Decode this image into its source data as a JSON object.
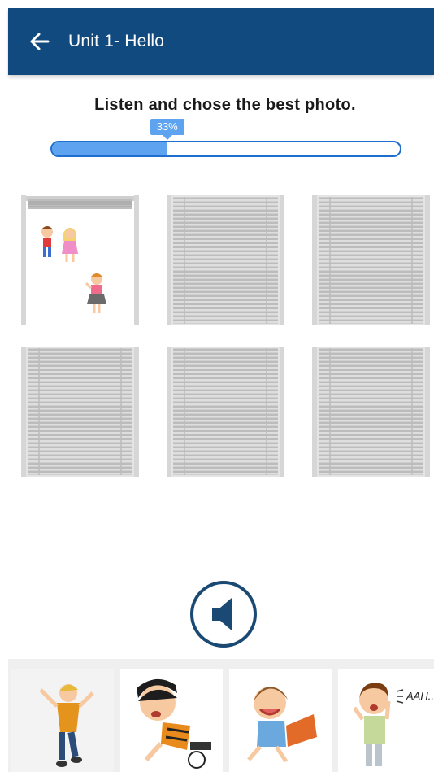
{
  "header": {
    "title": "Unit 1- Hello"
  },
  "instruction": "Listen and chose the best photo.",
  "progress": {
    "value": 33,
    "label": "33%"
  },
  "grid": [
    {
      "state": "revealed"
    },
    {
      "state": "closed"
    },
    {
      "state": "closed"
    },
    {
      "state": "closed"
    },
    {
      "state": "closed"
    },
    {
      "state": "closed"
    }
  ],
  "answers": [
    {
      "name": "boy-jumping"
    },
    {
      "name": "boy-fallen-with-ball"
    },
    {
      "name": "girl-crying-holding-knee"
    },
    {
      "name": "boy-toothache",
      "caption": "AAH.."
    }
  ],
  "colors": {
    "header": "#114a7e",
    "progress_border": "#1f6fd0",
    "progress_fill": "#5ea3ef",
    "audio": "#1a4a73"
  }
}
